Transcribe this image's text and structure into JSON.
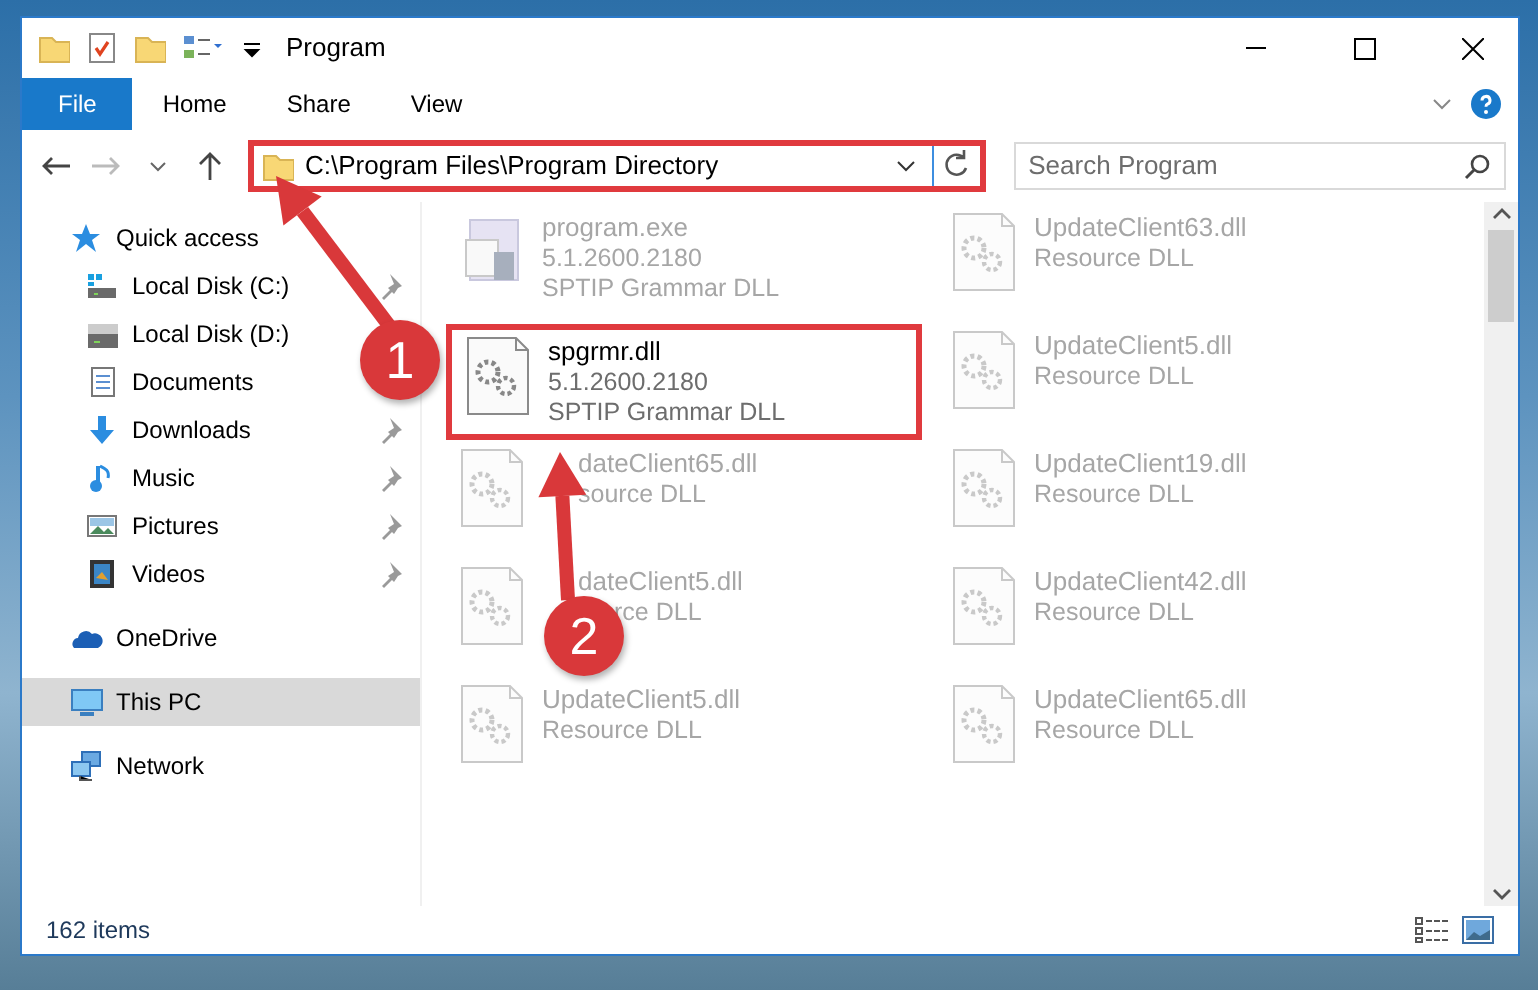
{
  "window": {
    "title": "Program"
  },
  "ribbon_tabs": [
    {
      "label": "File",
      "kind": "file"
    },
    {
      "label": "Home",
      "kind": "tab"
    },
    {
      "label": "Share",
      "kind": "tab"
    },
    {
      "label": "View",
      "kind": "tab"
    }
  ],
  "address_bar": {
    "path": "C:\\Program Files\\Program Directory",
    "highlighted": true
  },
  "search": {
    "placeholder": "Search Program"
  },
  "navigation": [
    {
      "label": "Quick access",
      "selected": false,
      "children": [
        {
          "label": "Local Disk (C:)",
          "pinned": true,
          "selected": false
        },
        {
          "label": "Local Disk (D:)",
          "selected": false
        },
        {
          "label": "Documents",
          "selected": false
        },
        {
          "label": "Downloads",
          "pinned": true,
          "selected": false
        },
        {
          "label": "Music",
          "pinned": true,
          "selected": false
        },
        {
          "label": "Pictures",
          "pinned": true,
          "selected": false
        },
        {
          "label": "Videos",
          "pinned": true,
          "selected": false
        }
      ]
    },
    {
      "label": "OneDrive",
      "selected": false
    },
    {
      "label": "This PC",
      "selected": true
    },
    {
      "label": "Network",
      "selected": false
    }
  ],
  "files": [
    {
      "name": "program.exe",
      "version": "5.1.2600.2180",
      "description": "SPTIP Grammar DLL",
      "kind": "exe",
      "dimmed": true,
      "highlighted": false
    },
    {
      "name": "UpdateClient63.dll",
      "description": "Resource DLL",
      "kind": "dll",
      "dimmed": true,
      "highlighted": false
    },
    {
      "name": "spgrmr.dll",
      "version": "5.1.2600.2180",
      "description": "SPTIP Grammar DLL",
      "kind": "dll",
      "dimmed": false,
      "highlighted": true
    },
    {
      "name": "UpdateClient5.dll",
      "description": "Resource DLL",
      "kind": "dll",
      "dimmed": true,
      "highlighted": false
    },
    {
      "name": "dateClient65.dll",
      "description": "source DLL",
      "kind": "dll",
      "dimmed": true,
      "highlighted": false
    },
    {
      "name": "UpdateClient19.dll",
      "description": "Resource DLL",
      "kind": "dll",
      "dimmed": true,
      "highlighted": false
    },
    {
      "name": "dateClient5.dll",
      "description": "rce DLL",
      "kind": "dll",
      "dimmed": true,
      "highlighted": false
    },
    {
      "name": "UpdateClient42.dll",
      "description": "Resource DLL",
      "kind": "dll",
      "dimmed": true,
      "highlighted": false
    },
    {
      "name": "UpdateClient5.dll",
      "description": "Resource DLL",
      "kind": "dll",
      "dimmed": true,
      "highlighted": false
    },
    {
      "name": "UpdateClient65.dll",
      "description": "Resource DLL",
      "kind": "dll",
      "dimmed": true,
      "highlighted": false
    }
  ],
  "status_bar": {
    "item_count": "162 items"
  },
  "annotations": [
    {
      "number": "1"
    },
    {
      "number": "2"
    }
  ]
}
